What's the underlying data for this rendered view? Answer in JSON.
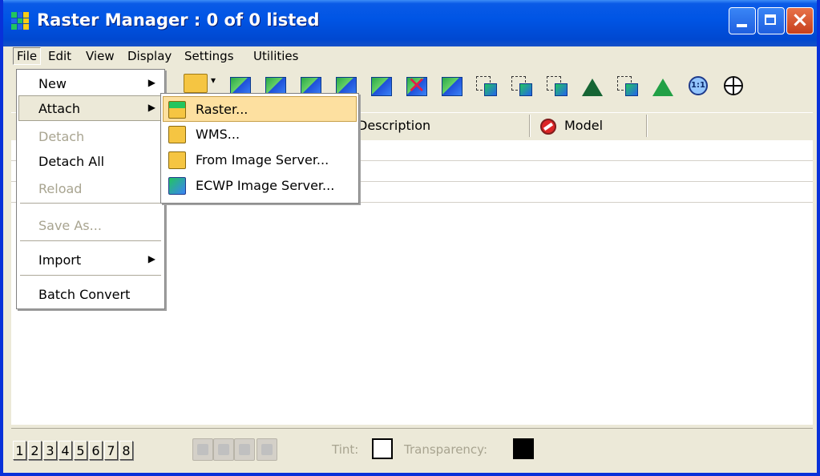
{
  "window": {
    "title": "Raster Manager : 0 of 0 listed"
  },
  "menubar": [
    "File",
    "Edit",
    "View",
    "Display",
    "Settings",
    "Utilities"
  ],
  "columns": {
    "description": "Description",
    "model": "Model"
  },
  "file_menu": {
    "items": [
      {
        "label": "New",
        "enabled": true,
        "submenu": true
      },
      {
        "label": "Attach",
        "enabled": true,
        "submenu": true,
        "highlighted": true
      },
      {
        "label": "Detach",
        "enabled": false
      },
      {
        "label": "Detach All",
        "enabled": true
      },
      {
        "label": "Reload",
        "enabled": false
      },
      {
        "label": "Save As...",
        "enabled": false
      },
      {
        "label": "Import",
        "enabled": true,
        "submenu": true
      },
      {
        "label": "Batch Convert",
        "enabled": true
      }
    ]
  },
  "attach_submenu": {
    "items": [
      {
        "label": "Raster...",
        "selected": true,
        "icon": "raster-folder-icon"
      },
      {
        "label": "WMS...",
        "icon": "wms-folder-icon"
      },
      {
        "label": "From Image Server...",
        "icon": "image-server-icon"
      },
      {
        "label": "ECWP Image Server...",
        "icon": "ecwp-server-icon"
      }
    ]
  },
  "bottombar": {
    "views": [
      "1",
      "2",
      "3",
      "4",
      "5",
      "6",
      "7",
      "8"
    ],
    "tint_label": "Tint:",
    "transparency_label": "Transparency:",
    "tint_color": "#ffffff",
    "transparency_color": "#000000"
  },
  "colors": {
    "titlebar": "#0055e5",
    "menu_highlight": "#fde0a0",
    "chrome": "#ece9d8"
  }
}
